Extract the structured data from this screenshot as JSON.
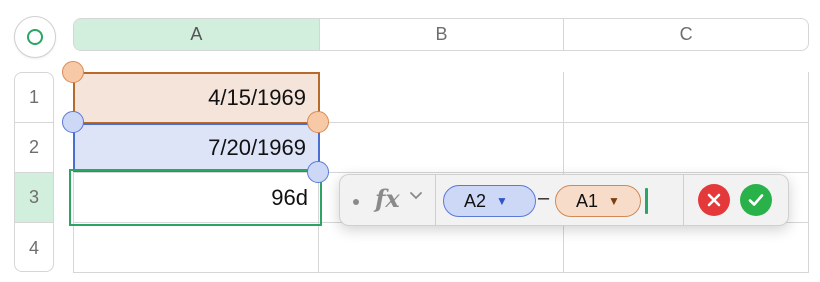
{
  "columns": [
    {
      "label": "A",
      "selected": true
    },
    {
      "label": "B",
      "selected": false
    },
    {
      "label": "C",
      "selected": false
    }
  ],
  "rows": [
    {
      "label": "1",
      "selected": false
    },
    {
      "label": "2",
      "selected": false
    },
    {
      "label": "3",
      "selected": true
    },
    {
      "label": "4",
      "selected": false
    }
  ],
  "cells": {
    "A1": "4/15/1969",
    "A2": "7/20/1969",
    "A3": "96d"
  },
  "formula_editor": {
    "fx_label": "fx",
    "token_1": "A2",
    "operator": "–",
    "token_2": "A1",
    "icons": {
      "token_1_dropdown": "triangle-down-icon",
      "token_2_dropdown": "triangle-down-icon",
      "cancel": "cancel-x-icon",
      "accept": "checkmark-icon"
    }
  },
  "colors": {
    "accent_green": "#2aa564",
    "ref_orange": "#b86a2a",
    "ref_blue": "#4a6fd0",
    "cancel_red": "#e5383b",
    "accept_green": "#2ab24a"
  }
}
